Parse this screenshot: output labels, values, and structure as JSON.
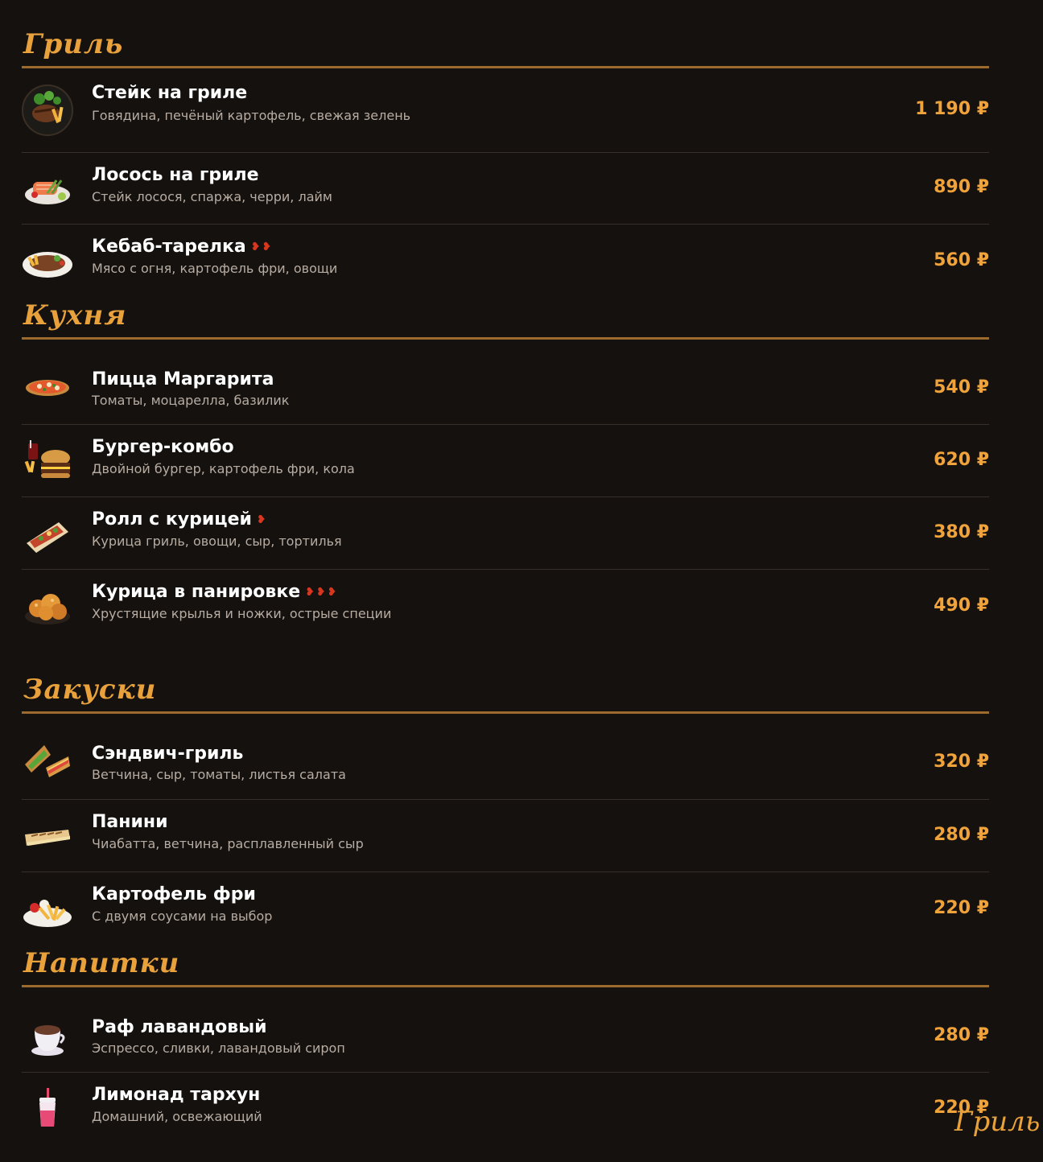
{
  "sections": [
    {
      "title": "Гриль",
      "items": [
        {
          "name": "Стейк на гриле",
          "desc": "Говядина, печёный картофель, свежая зелень",
          "price": "1 190 ₽",
          "icon": "steak-icon",
          "chili": ""
        },
        {
          "name": "Лосось на гриле",
          "desc": "Стейк лосося, спаржа, черри, лайм",
          "price": "890 ₽",
          "icon": "salmon-icon",
          "chili": ""
        },
        {
          "name": "Кебаб-тарелка",
          "desc": "Мясо с огня, картофель фри, овощи",
          "price": "560 ₽",
          "icon": "kebab-icon",
          "chili": "❥❥"
        }
      ]
    },
    {
      "title": "Кухня",
      "items": [
        {
          "name": "Пицца Маргарита",
          "desc": "Томаты, моцарелла, базилик",
          "price": "540 ₽",
          "icon": "pizza-icon",
          "chili": ""
        },
        {
          "name": "Бургер-комбо",
          "desc": "Двойной бургер, картофель фри, кола",
          "price": "620 ₽",
          "icon": "burger-icon",
          "chili": ""
        },
        {
          "name": "Ролл с курицей",
          "desc": "Курица гриль, овощи, сыр, тортилья",
          "price": "380 ₽",
          "icon": "wrap-icon",
          "chili": "❥"
        },
        {
          "name": "Курица в панировке",
          "desc": "Хрустящие крылья и ножки, острые специи",
          "price": "490 ₽",
          "icon": "fried-chicken-icon",
          "chili": "❥❥❥"
        }
      ]
    },
    {
      "title": "Закуски",
      "items": [
        {
          "name": "Сэндвич-гриль",
          "desc": "Ветчина, сыр, томаты, листья салата",
          "price": "320 ₽",
          "icon": "sandwich-icon",
          "chili": ""
        },
        {
          "name": "Панини",
          "desc": "Чиабатта, ветчина, расплавленный сыр",
          "price": "280 ₽",
          "icon": "panini-icon",
          "chili": ""
        },
        {
          "name": "Картофель фри",
          "desc": "С двумя соусами на выбор",
          "price": "220 ₽",
          "icon": "fries-icon",
          "chili": ""
        }
      ]
    },
    {
      "title": "Напитки",
      "items": [
        {
          "name": "Раф лавандовый",
          "desc": "Эспрессо, сливки, лавандовый сироп",
          "price": "280 ₽",
          "icon": "coffee-icon",
          "chili": ""
        },
        {
          "name": "Лимонад тархун",
          "desc": "Домашний, освежающий",
          "price": "220 ₽",
          "icon": "lemonade-icon",
          "chili": ""
        }
      ]
    }
  ],
  "overlay_text": "Гриль",
  "colors": {
    "background": "#15110f",
    "accent": "#f0a33a",
    "rule": "#9b6a2c",
    "chili": "#d8371f"
  }
}
